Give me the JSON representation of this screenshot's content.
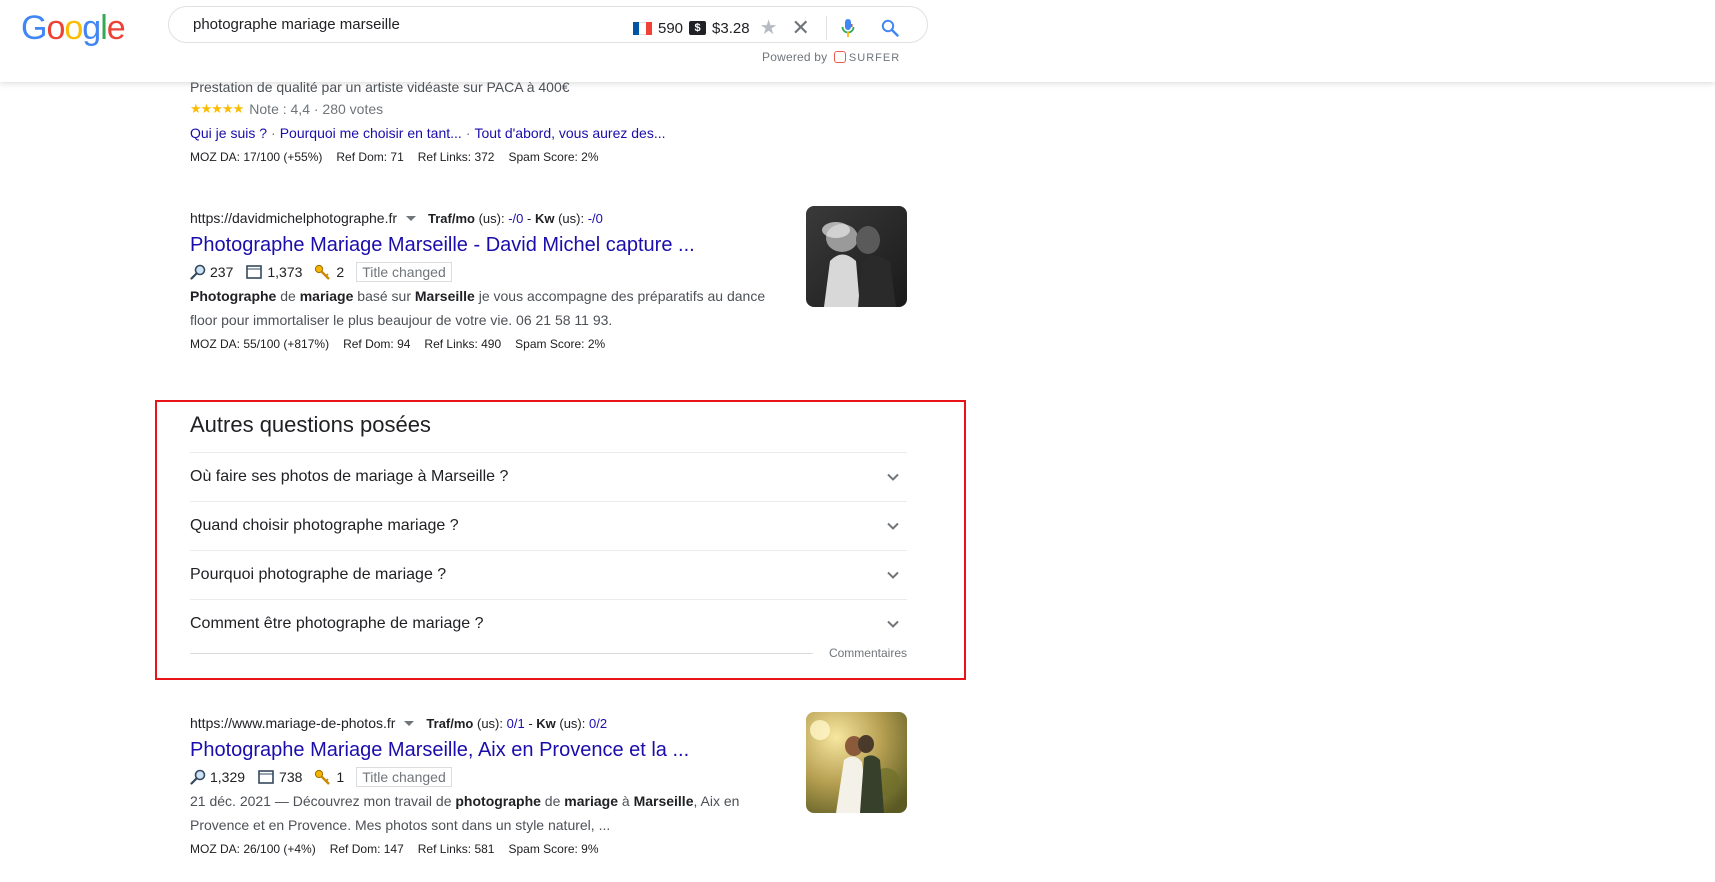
{
  "header": {
    "logo": [
      "G",
      "o",
      "o",
      "g",
      "l",
      "e"
    ],
    "logo_colors": [
      "#4285F4",
      "#EA4335",
      "#FBBC05",
      "#4285F4",
      "#34A853",
      "#EA4335"
    ],
    "search_query": "photographe mariage marseille",
    "volume": "590",
    "cpc": "$3.28",
    "powered_by": "Powered by",
    "surfer": "SURFER"
  },
  "result1": {
    "snippet": "Prestation de qualité par un artiste vidéaste sur PACA à 400€",
    "stars": "★★★★★",
    "rating": "Note : 4,4 · 280 votes",
    "sitelinks": [
      "Qui je suis ?",
      "Pourquoi me choisir en tant...",
      "Tout d'abord, vous aurez des..."
    ],
    "moz": [
      "MOZ DA: 17/100 (+55%)",
      "Ref Dom: 71",
      "Ref Links: 372",
      "Spam Score: 2%"
    ]
  },
  "result2": {
    "url": "https://davidmichelphotographe.fr",
    "traf_label": "Traf/mo",
    "traf_us": " (us): ",
    "traf_value": "-/0",
    "kw_label": "Kw",
    "kw_us": " (us): ",
    "kw_value": "-/0",
    "title": "Photographe Mariage Marseille - David Michel capture ...",
    "stat_search": "237",
    "stat_pages": "1,373",
    "stat_keys": "2",
    "tag": "Title changed",
    "snippet_parts": [
      {
        "t": "Photographe",
        "b": true
      },
      {
        "t": " de ",
        "b": false
      },
      {
        "t": "mariage",
        "b": true
      },
      {
        "t": " basé sur ",
        "b": false
      },
      {
        "t": "Marseille",
        "b": true
      },
      {
        "t": " je vous accompagne des préparatifs au dance floor pour immortaliser le plus beaujour de votre vie. 06 21 58 11 93.",
        "b": false
      }
    ],
    "moz": [
      "MOZ DA: 55/100 (+817%)",
      "Ref Dom: 94",
      "Ref Links: 490",
      "Spam Score: 2%"
    ]
  },
  "paa": {
    "title": "Autres questions posées",
    "questions": [
      "Où faire ses photos de mariage à Marseille ?",
      "Quand choisir photographe mariage ?",
      "Pourquoi photographe de mariage ?",
      "Comment être photographe de mariage ?"
    ],
    "feedback": "Commentaires"
  },
  "result3": {
    "url": "https://www.mariage-de-photos.fr",
    "traf_label": "Traf/mo",
    "traf_us": " (us): ",
    "traf_value": "0/1",
    "kw_label": "Kw",
    "kw_us": " (us): ",
    "kw_value": "0/2",
    "title": "Photographe Mariage Marseille, Aix en Provence et la ...",
    "stat_search": "1,329",
    "stat_pages": "738",
    "stat_keys": "1",
    "tag": "Title changed",
    "snippet_parts": [
      {
        "t": "21 déc. 2021 — Découvrez mon travail de ",
        "b": false
      },
      {
        "t": "photographe",
        "b": true
      },
      {
        "t": " de ",
        "b": false
      },
      {
        "t": "mariage",
        "b": true
      },
      {
        "t": " à ",
        "b": false
      },
      {
        "t": "Marseille",
        "b": true
      },
      {
        "t": ", Aix en Provence et en Provence. Mes photos sont dans un style naturel, ...",
        "b": false
      }
    ],
    "moz": [
      "MOZ DA: 26/100 (+4%)",
      "Ref Dom: 147",
      "Ref Links: 581",
      "Spam Score: 9%"
    ]
  }
}
